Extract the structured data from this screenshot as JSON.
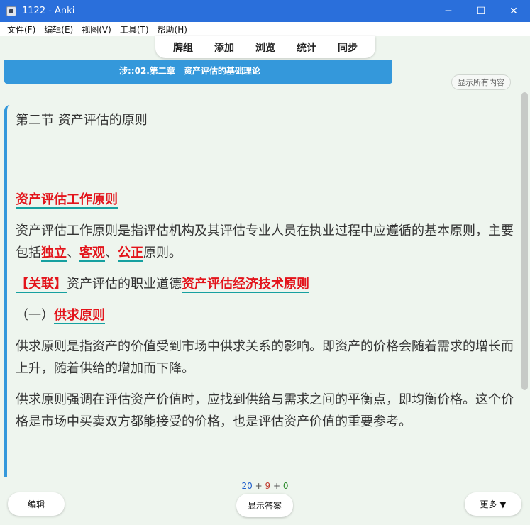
{
  "window": {
    "title": "1122 - Anki",
    "minimize": "─",
    "maximize": "☐",
    "close": "✕"
  },
  "menu": [
    "文件(F)",
    "编辑(E)",
    "视图(V)",
    "工具(T)",
    "帮助(H)"
  ],
  "nav": [
    "牌组",
    "添加",
    "浏览",
    "统计",
    "同步"
  ],
  "deck": {
    "path_line1": "ᵗ ⁓ ⁘ ꟸ ⁘ ꟸ ⁘",
    "path_line2": "涉::02.第二章　资产评估的基础理论"
  },
  "show_all_label": "显示所有内容",
  "card": {
    "section_title": "第二节 资产评估的原则",
    "heading1": "资产评估工作原则",
    "para1_a": "资产评估工作原则是指评估机构及其评估专业人员在执业过程中应遵循的基本原则，主要包括",
    "para1_k1": "独立",
    "para1_sep1": "、",
    "para1_k2": "客观",
    "para1_sep2": "、",
    "para1_k3": "公正",
    "para1_end": "原则。",
    "link_tag": "【关联】",
    "link_text": "资产评估的职业道德",
    "link_red": "资产评估经济技术原则",
    "sub_num": "（一）",
    "sub_title": "供求原则",
    "para2": "供求原则是指资产的价值受到市场中供求关系的影响。即资产的价格会随着需求的增长而上升，随着供给的增加而下降。",
    "para3": "供求原则强调在评估资产价值时，应找到供给与需求之间的平衡点，即均衡价格。这个价格是市场中买卖双方都能接受的价格，也是评估资产价值的重要参考。"
  },
  "counts": {
    "new": "20",
    "plus1": " + ",
    "learn": "9",
    "plus2": " + ",
    "review": "0"
  },
  "buttons": {
    "edit": "编辑",
    "show_answer": "显示答案",
    "more": "更多 ▼"
  },
  "colors": {
    "titlebar": "#2a6fdb",
    "accent_blue": "#3498db",
    "highlight_red": "#e3141b",
    "underline_teal": "#16a0a0",
    "background": "#eef5ee"
  }
}
